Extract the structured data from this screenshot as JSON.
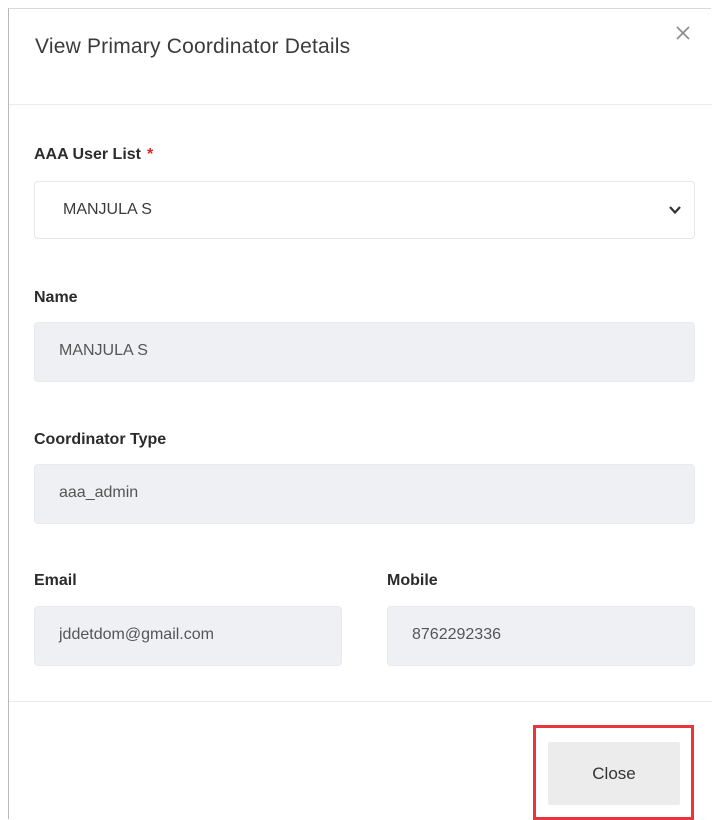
{
  "modal": {
    "title": "View Primary Coordinator Details"
  },
  "form": {
    "user_list": {
      "label": "AAA User List",
      "required_marker": "*",
      "selected": "MANJULA S"
    },
    "name": {
      "label": "Name",
      "value": "MANJULA S"
    },
    "coordinator_type": {
      "label": "Coordinator Type",
      "value": "aaa_admin"
    },
    "email": {
      "label": "Email",
      "value": "jddetdom@gmail.com"
    },
    "mobile": {
      "label": "Mobile",
      "value": "8762292336"
    }
  },
  "footer": {
    "close_label": "Close"
  },
  "colors": {
    "highlight": "#e8343c",
    "required": "#e02424",
    "readonly_bg": "#eef0f4"
  },
  "icons": {
    "close": "close-icon",
    "dropdown": "chevron-down-icon"
  }
}
